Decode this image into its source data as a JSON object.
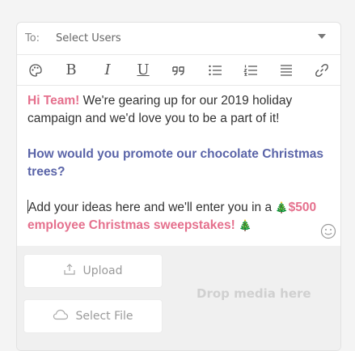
{
  "to": {
    "label": "To:",
    "placeholder": "Select Users"
  },
  "toolbar": {
    "bold": "B",
    "italic": "I",
    "underline": "U"
  },
  "message": {
    "p1_greeting": "Hi Team!",
    "p1_rest": " We're gearing up for our 2019 holiday campaign and we'd love you to be a part of it!",
    "p2_question": "How would you promote our chocolate Christmas trees?",
    "p3_text": "Add your ideas here and we'll enter you in a ",
    "p3_prize": "$500 employee Christmas sweepstakes!",
    "tree_emoji": "🎄"
  },
  "media": {
    "upload_label": "Upload",
    "select_file_label": "Select File",
    "drop_label": "Drop media here"
  },
  "colors": {
    "pink": "#e5708d",
    "purple": "#5a64a8"
  }
}
